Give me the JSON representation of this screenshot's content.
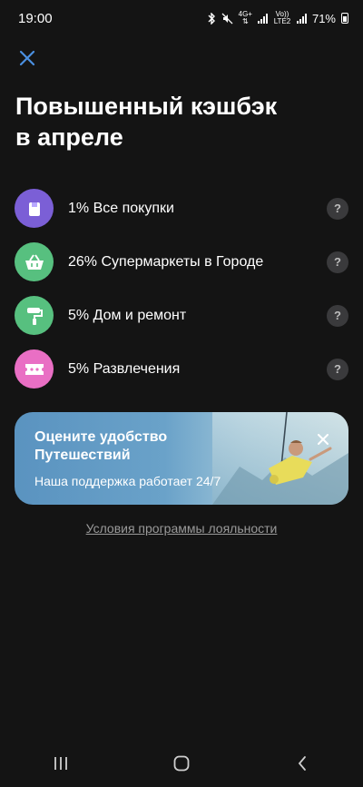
{
  "status_bar": {
    "time": "19:00",
    "network_top": "4G+",
    "network_bottom": "Vo)) LTE2",
    "battery": "71%"
  },
  "header": {
    "title_line1": "Повышенный кэшбэк",
    "title_line2": "в апреле"
  },
  "cashback": {
    "items": [
      {
        "label": "1% Все покупки",
        "icon": "shopping-bag-icon",
        "color": "#7b5fd6"
      },
      {
        "label": "26% Супермаркеты в Городе",
        "icon": "basket-icon",
        "color": "#57c07f"
      },
      {
        "label": "5% Дом и ремонт",
        "icon": "paint-roller-icon",
        "color": "#57c07f"
      },
      {
        "label": "5% Развлечения",
        "icon": "ticket-icon",
        "color": "#e96fc4"
      }
    ],
    "help_glyph": "?"
  },
  "banner": {
    "title": "Оцените удобство Путешествий",
    "subtitle": "Наша поддержка работает 24/7"
  },
  "footer": {
    "loyalty_link": "Условия программы лояльности"
  },
  "colors": {
    "background": "#141414",
    "accent_blue": "#4a8fe0",
    "banner_blue": "#5a93c0"
  }
}
